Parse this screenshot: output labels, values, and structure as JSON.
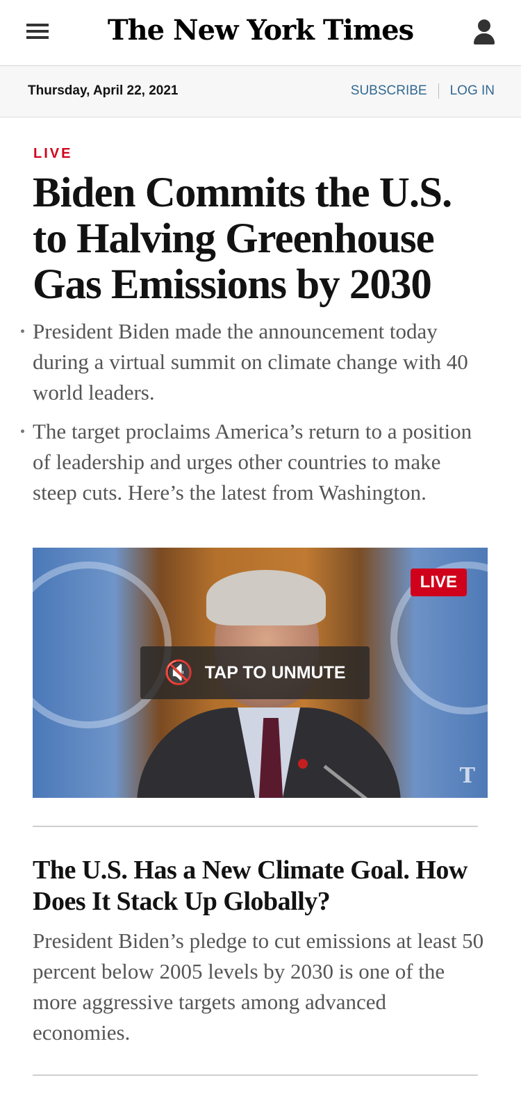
{
  "header": {
    "logo_text": "The New York Times",
    "menu_icon": "menu-icon",
    "account_icon": "account-icon"
  },
  "datebar": {
    "date": "Thursday, April 22, 2021",
    "subscribe": "SUBSCRIBE",
    "login": "LOG IN"
  },
  "lead_story": {
    "kicker": "LIVE",
    "headline": "Biden Commits the U.S. to Halving Greenhouse Gas Emissions by 2030",
    "bullets": [
      "President Biden made the announcement today during a virtual summit on climate change with 40 world leaders.",
      "The target proclaims America’s return to a position of leadership and urges other countries to make steep cuts. Here’s the latest from Washington."
    ]
  },
  "video": {
    "live_badge": "LIVE",
    "unmute_label": "TAP TO UNMUTE",
    "watermark": "T"
  },
  "second_story": {
    "headline": "The U.S. Has a New Climate Goal. How Does It Stack Up Globally?",
    "summary": "President Biden’s pledge to cut emissions at least 50 percent below 2005 levels by 2030 is one of the more aggressive targets among advanced economies."
  },
  "colors": {
    "live_red": "#d0021b",
    "link_blue": "#326891"
  }
}
